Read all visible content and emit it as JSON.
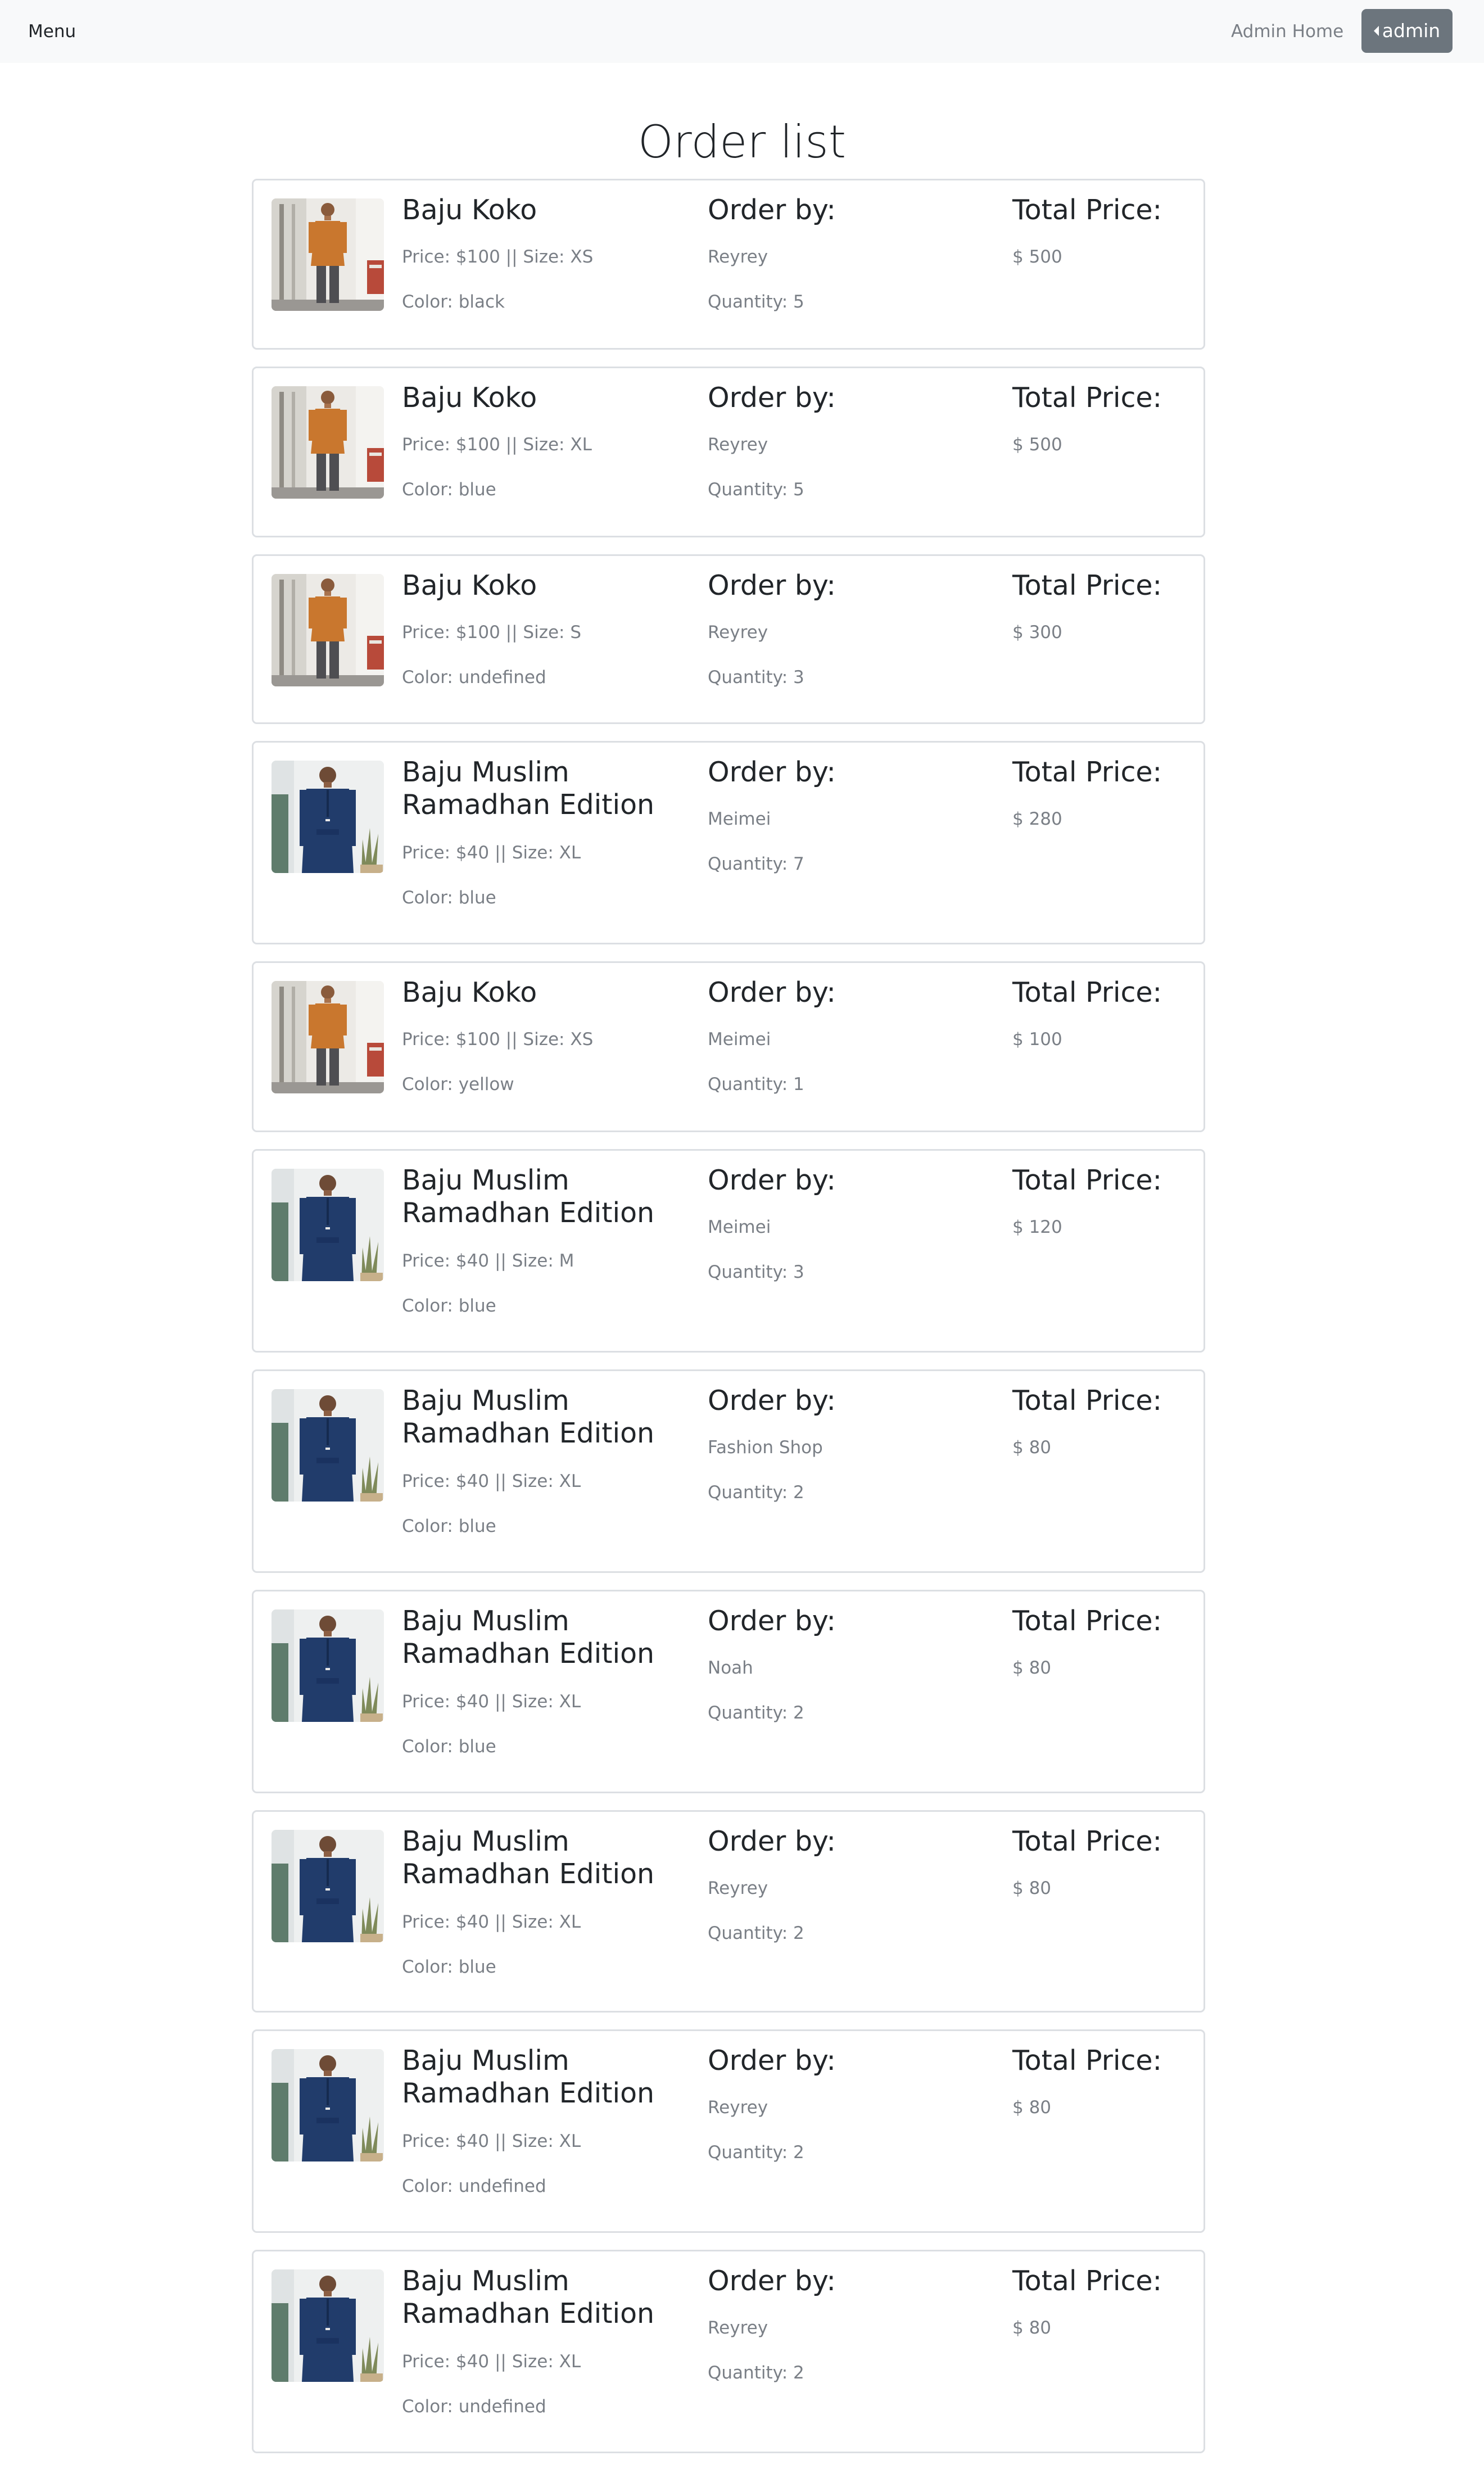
{
  "navbar": {
    "menu_label": "Menu",
    "admin_home_label": "Admin Home",
    "admin_button_label": "admin",
    "background": "#f8f9fa",
    "button_color": "#6c757d"
  },
  "page": {
    "title": "Order list"
  },
  "labels": {
    "order_by": "Order by:",
    "total_price": "Total Price:"
  },
  "orders": [
    {
      "product": "Baju Koko",
      "image": "baju-koko-orange-icon",
      "price_size": "Price: $100 || Size: XS",
      "color": "Color: black",
      "customer": "Reyrey",
      "quantity": "Quantity: 5",
      "total": "$ 500"
    },
    {
      "product": "Baju Koko",
      "image": "baju-koko-orange-icon",
      "price_size": "Price: $100 || Size: XL",
      "color": "Color: blue",
      "customer": "Reyrey",
      "quantity": "Quantity: 5",
      "total": "$ 500"
    },
    {
      "product": "Baju Koko",
      "image": "baju-koko-orange-icon",
      "price_size": "Price: $100 || Size: S",
      "color": "Color: undefined",
      "customer": "Reyrey",
      "quantity": "Quantity: 3",
      "total": "$ 300"
    },
    {
      "product": "Baju Muslim Ramadhan Edition",
      "image": "baju-muslim-navy-icon",
      "price_size": "Price: $40 || Size: XL",
      "color": "Color: blue",
      "customer": "Meimei",
      "quantity": "Quantity: 7",
      "total": "$ 280"
    },
    {
      "product": "Baju Koko",
      "image": "baju-koko-orange-icon",
      "price_size": "Price: $100 || Size: XS",
      "color": "Color: yellow",
      "customer": "Meimei",
      "quantity": "Quantity: 1",
      "total": "$ 100"
    },
    {
      "product": "Baju Muslim Ramadhan Edition",
      "image": "baju-muslim-navy-icon",
      "price_size": "Price: $40 || Size: M",
      "color": "Color: blue",
      "customer": "Meimei",
      "quantity": "Quantity: 3",
      "total": "$ 120"
    },
    {
      "product": "Baju Muslim Ramadhan Edition",
      "image": "baju-muslim-navy-icon",
      "price_size": "Price: $40 || Size: XL",
      "color": "Color: blue",
      "customer": "Fashion Shop",
      "quantity": "Quantity: 2",
      "total": "$ 80"
    },
    {
      "product": "Baju Muslim Ramadhan Edition",
      "image": "baju-muslim-navy-icon",
      "price_size": "Price: $40 || Size: XL",
      "color": "Color: blue",
      "customer": "Noah",
      "quantity": "Quantity: 2",
      "total": "$ 80"
    },
    {
      "product": "Baju Muslim Ramadhan Edition",
      "image": "baju-muslim-navy-icon",
      "price_size": "Price: $40 || Size: XL",
      "color": "Color: blue",
      "customer": "Reyrey",
      "quantity": "Quantity: 2",
      "total": "$ 80"
    },
    {
      "product": "Baju Muslim Ramadhan Edition",
      "image": "baju-muslim-navy-icon",
      "price_size": "Price: $40 || Size: XL",
      "color": "Color: undefined",
      "customer": "Reyrey",
      "quantity": "Quantity: 2",
      "total": "$ 80"
    },
    {
      "product": "Baju Muslim Ramadhan Edition",
      "image": "baju-muslim-navy-icon",
      "price_size": "Price: $40 || Size: XL",
      "color": "Color: undefined",
      "customer": "Reyrey",
      "quantity": "Quantity: 2",
      "total": "$ 80"
    }
  ]
}
